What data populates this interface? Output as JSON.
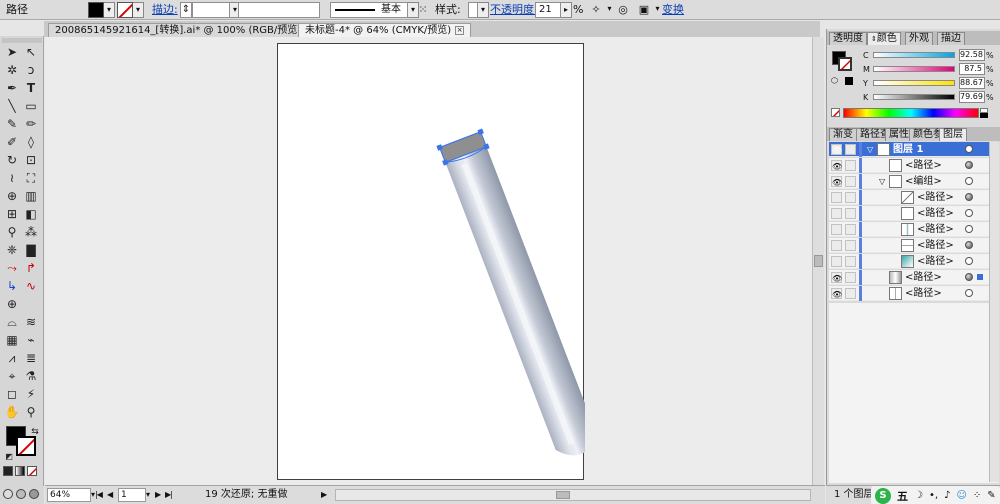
{
  "control_bar": {
    "object_type": "路径",
    "stroke_label": "描边:",
    "stroke_profile": "基本",
    "style_label": "样式:",
    "opacity_label": "不透明度:",
    "opacity_value": "21",
    "opacity_unit": "%",
    "transform_label": "变换"
  },
  "tabs": [
    {
      "label": "200865145921614_[转换].ai* @ 100% (RGB/预览)",
      "active": false
    },
    {
      "label": "未标题-4* @ 64% (CMYK/预览)",
      "active": true
    }
  ],
  "color_panel": {
    "tabs": [
      "透明度",
      "颜色",
      "外观",
      "描边"
    ],
    "active_tab": "颜色",
    "channels": [
      {
        "name": "C",
        "value": "92.58",
        "gradient": "#00a6e4"
      },
      {
        "name": "M",
        "value": "87.5",
        "gradient": "#e2007a"
      },
      {
        "name": "Y",
        "value": "88.67",
        "gradient": "#ffe100"
      },
      {
        "name": "K",
        "value": "79.69",
        "gradient": "#000000"
      }
    ],
    "pct": "%"
  },
  "layers_panel": {
    "tabs": [
      "渐变",
      "路径查",
      "属性",
      "颜色参",
      "图层"
    ],
    "active_tab": "图层",
    "rows": [
      {
        "label": "图层 1",
        "indent": 0,
        "selected": true,
        "eye": true,
        "target_filled": false
      },
      {
        "label": "<路径>",
        "indent": 1,
        "selected": false,
        "eye": true,
        "target_filled": true
      },
      {
        "label": "<编组>",
        "indent": 1,
        "selected": false,
        "eye": true,
        "target_filled": false
      },
      {
        "label": "<路径>",
        "indent": 2,
        "selected": false,
        "eye": false,
        "target_filled": true
      },
      {
        "label": "<路径>",
        "indent": 2,
        "selected": false,
        "eye": false,
        "target_filled": false
      },
      {
        "label": "<路径>",
        "indent": 2,
        "selected": false,
        "eye": false,
        "target_filled": false
      },
      {
        "label": "<路径>",
        "indent": 2,
        "selected": false,
        "eye": false,
        "target_filled": true
      },
      {
        "label": "<路径>",
        "indent": 2,
        "selected": false,
        "eye": false,
        "target_filled": false
      },
      {
        "label": "<路径>",
        "indent": 1,
        "selected": false,
        "eye": true,
        "target_filled": true
      },
      {
        "label": "<路径>",
        "indent": 1,
        "selected": false,
        "eye": true,
        "target_filled": false
      }
    ],
    "footer": "1 个图层"
  },
  "status_bar": {
    "zoom": "64%",
    "page": "1",
    "history": "19 次还原; 无重做"
  },
  "taskbar": {
    "ime_label": "五"
  },
  "colors": {
    "tube_light": "#dde2ec",
    "tube_dark": "#9aa3b3",
    "cap_gray": "#8f8f8f",
    "selection_blue": "#3a74e8"
  }
}
